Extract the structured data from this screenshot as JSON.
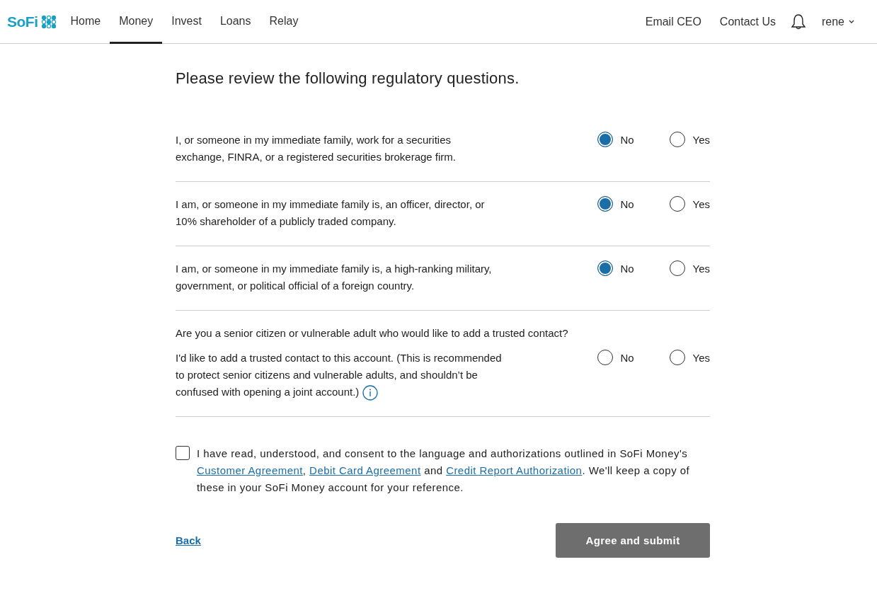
{
  "nav": {
    "logo": "SoFi",
    "items": [
      {
        "label": "Home",
        "selected": false
      },
      {
        "label": "Money",
        "selected": true
      },
      {
        "label": "Invest",
        "selected": false
      },
      {
        "label": "Loans",
        "selected": false
      },
      {
        "label": "Relay",
        "selected": false
      }
    ],
    "right_links": [
      "Email CEO",
      "Contact Us"
    ],
    "user": "rene"
  },
  "title": "Please review the following regulatory questions.",
  "questions": [
    {
      "text": "I, or someone in my immediate family, work for a securities exchange, FINRA, or a registered securities brokerage firm.",
      "info": false,
      "options": [
        {
          "label": "No",
          "selected": true
        },
        {
          "label": "Yes",
          "selected": false
        }
      ]
    },
    {
      "text": "I am, or someone in my immediate family is, an officer, director, or 10% shareholder of a publicly traded company.",
      "info": false,
      "options": [
        {
          "label": "No",
          "selected": true
        },
        {
          "label": "Yes",
          "selected": false
        }
      ]
    },
    {
      "text": "I am, or someone in my immediate family is, a high-ranking military, government, or political official of a foreign country.",
      "info": false,
      "options": [
        {
          "label": "No",
          "selected": true
        },
        {
          "label": "Yes",
          "selected": false
        }
      ]
    },
    {
      "heading": "Are you a senior citizen or vulnerable adult who would like to add a trusted contact?",
      "text": "I'd like to add a trusted contact to this account. (This is recommended to protect senior citizens and vulnerable adults, and shouldn’t be confused with opening a joint account.)",
      "info": true,
      "options": [
        {
          "label": "No",
          "selected": false
        },
        {
          "label": "Yes",
          "selected": false
        }
      ]
    }
  ],
  "consent": {
    "checked": false,
    "parts": [
      {
        "kind": "text",
        "text": "I have read, understood, and consent to the language and authorizations outlined in SoFi Money's "
      },
      {
        "kind": "link",
        "text": "Customer Agreement"
      },
      {
        "kind": "text",
        "text": ", "
      },
      {
        "kind": "link",
        "text": "Debit Card Agreement"
      },
      {
        "kind": "text",
        "text": " and "
      },
      {
        "kind": "link",
        "text": "Credit Report Authorization"
      },
      {
        "kind": "text",
        "text": ". We'll keep a copy of these in your SoFi Money account for your reference."
      }
    ]
  },
  "back": "Back",
  "submit": "Agree and submit"
}
